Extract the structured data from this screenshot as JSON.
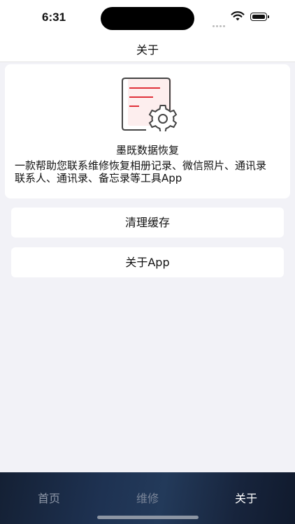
{
  "status_bar": {
    "time": "6:31"
  },
  "nav": {
    "title": "关于"
  },
  "info": {
    "icon": "document-gear-icon",
    "app_name": "墨既数据恢复",
    "description": "一款帮助您联系维修恢复相册记录、微信照片、通讯录联系人、通讯录、备忘录等工具App"
  },
  "buttons": {
    "clear_cache": "清理缓存",
    "about_app": "关于App"
  },
  "tabs": [
    {
      "label": "首页",
      "active": false
    },
    {
      "label": "维修",
      "active": false
    },
    {
      "label": "关于",
      "active": true
    }
  ],
  "colors": {
    "accent_red": "#e0303a",
    "tab_bar_bg": "#1e3252",
    "page_bg": "#f2f2f7"
  }
}
